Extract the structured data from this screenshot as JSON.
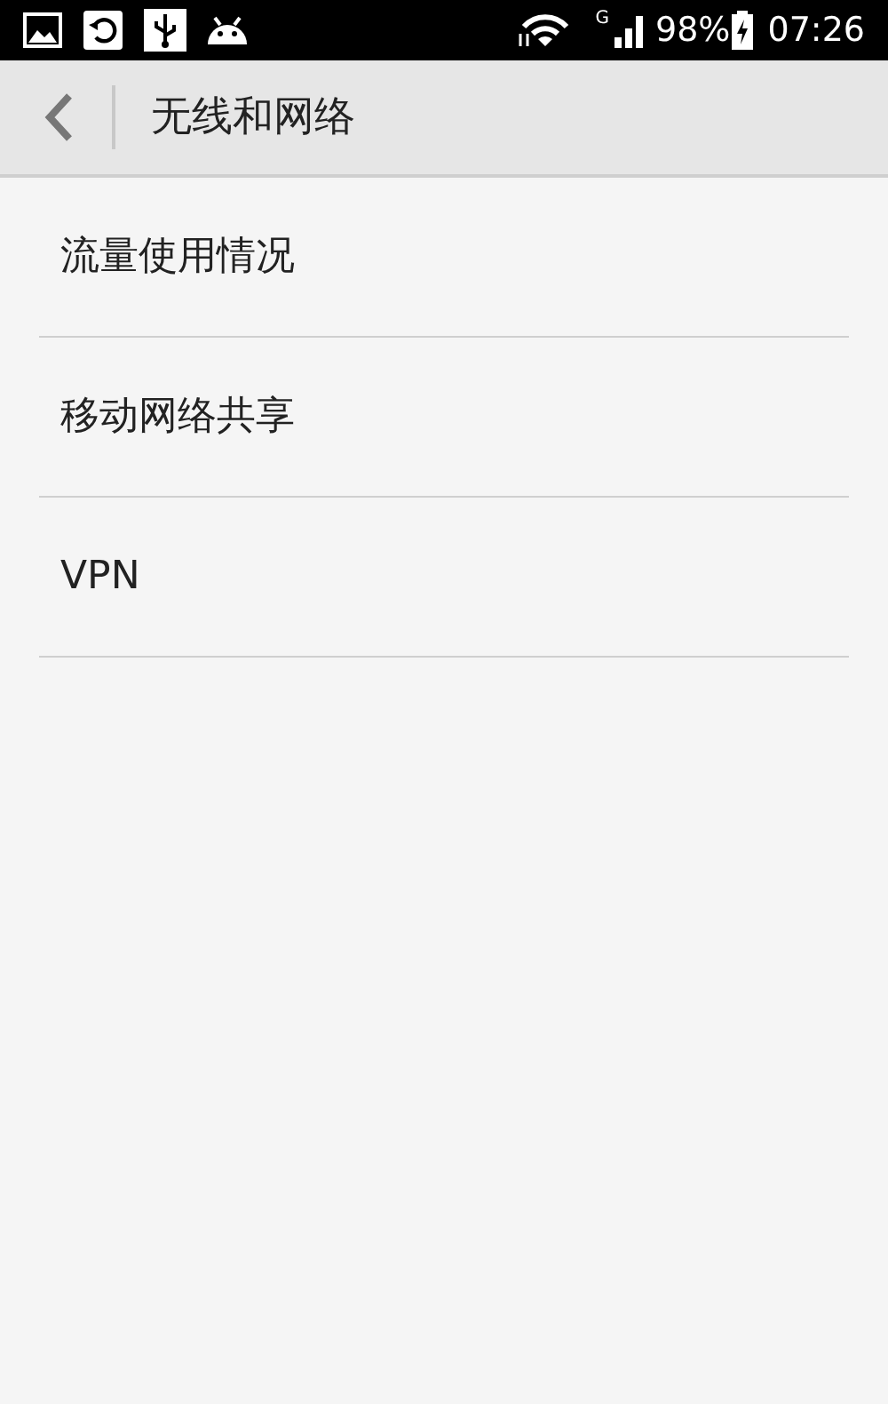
{
  "status_bar": {
    "network_type": "G",
    "battery": "98%",
    "time": "07:26"
  },
  "header": {
    "title": "无线和网络"
  },
  "items": [
    {
      "label": "流量使用情况"
    },
    {
      "label": "移动网络共享"
    },
    {
      "label": "VPN"
    }
  ]
}
